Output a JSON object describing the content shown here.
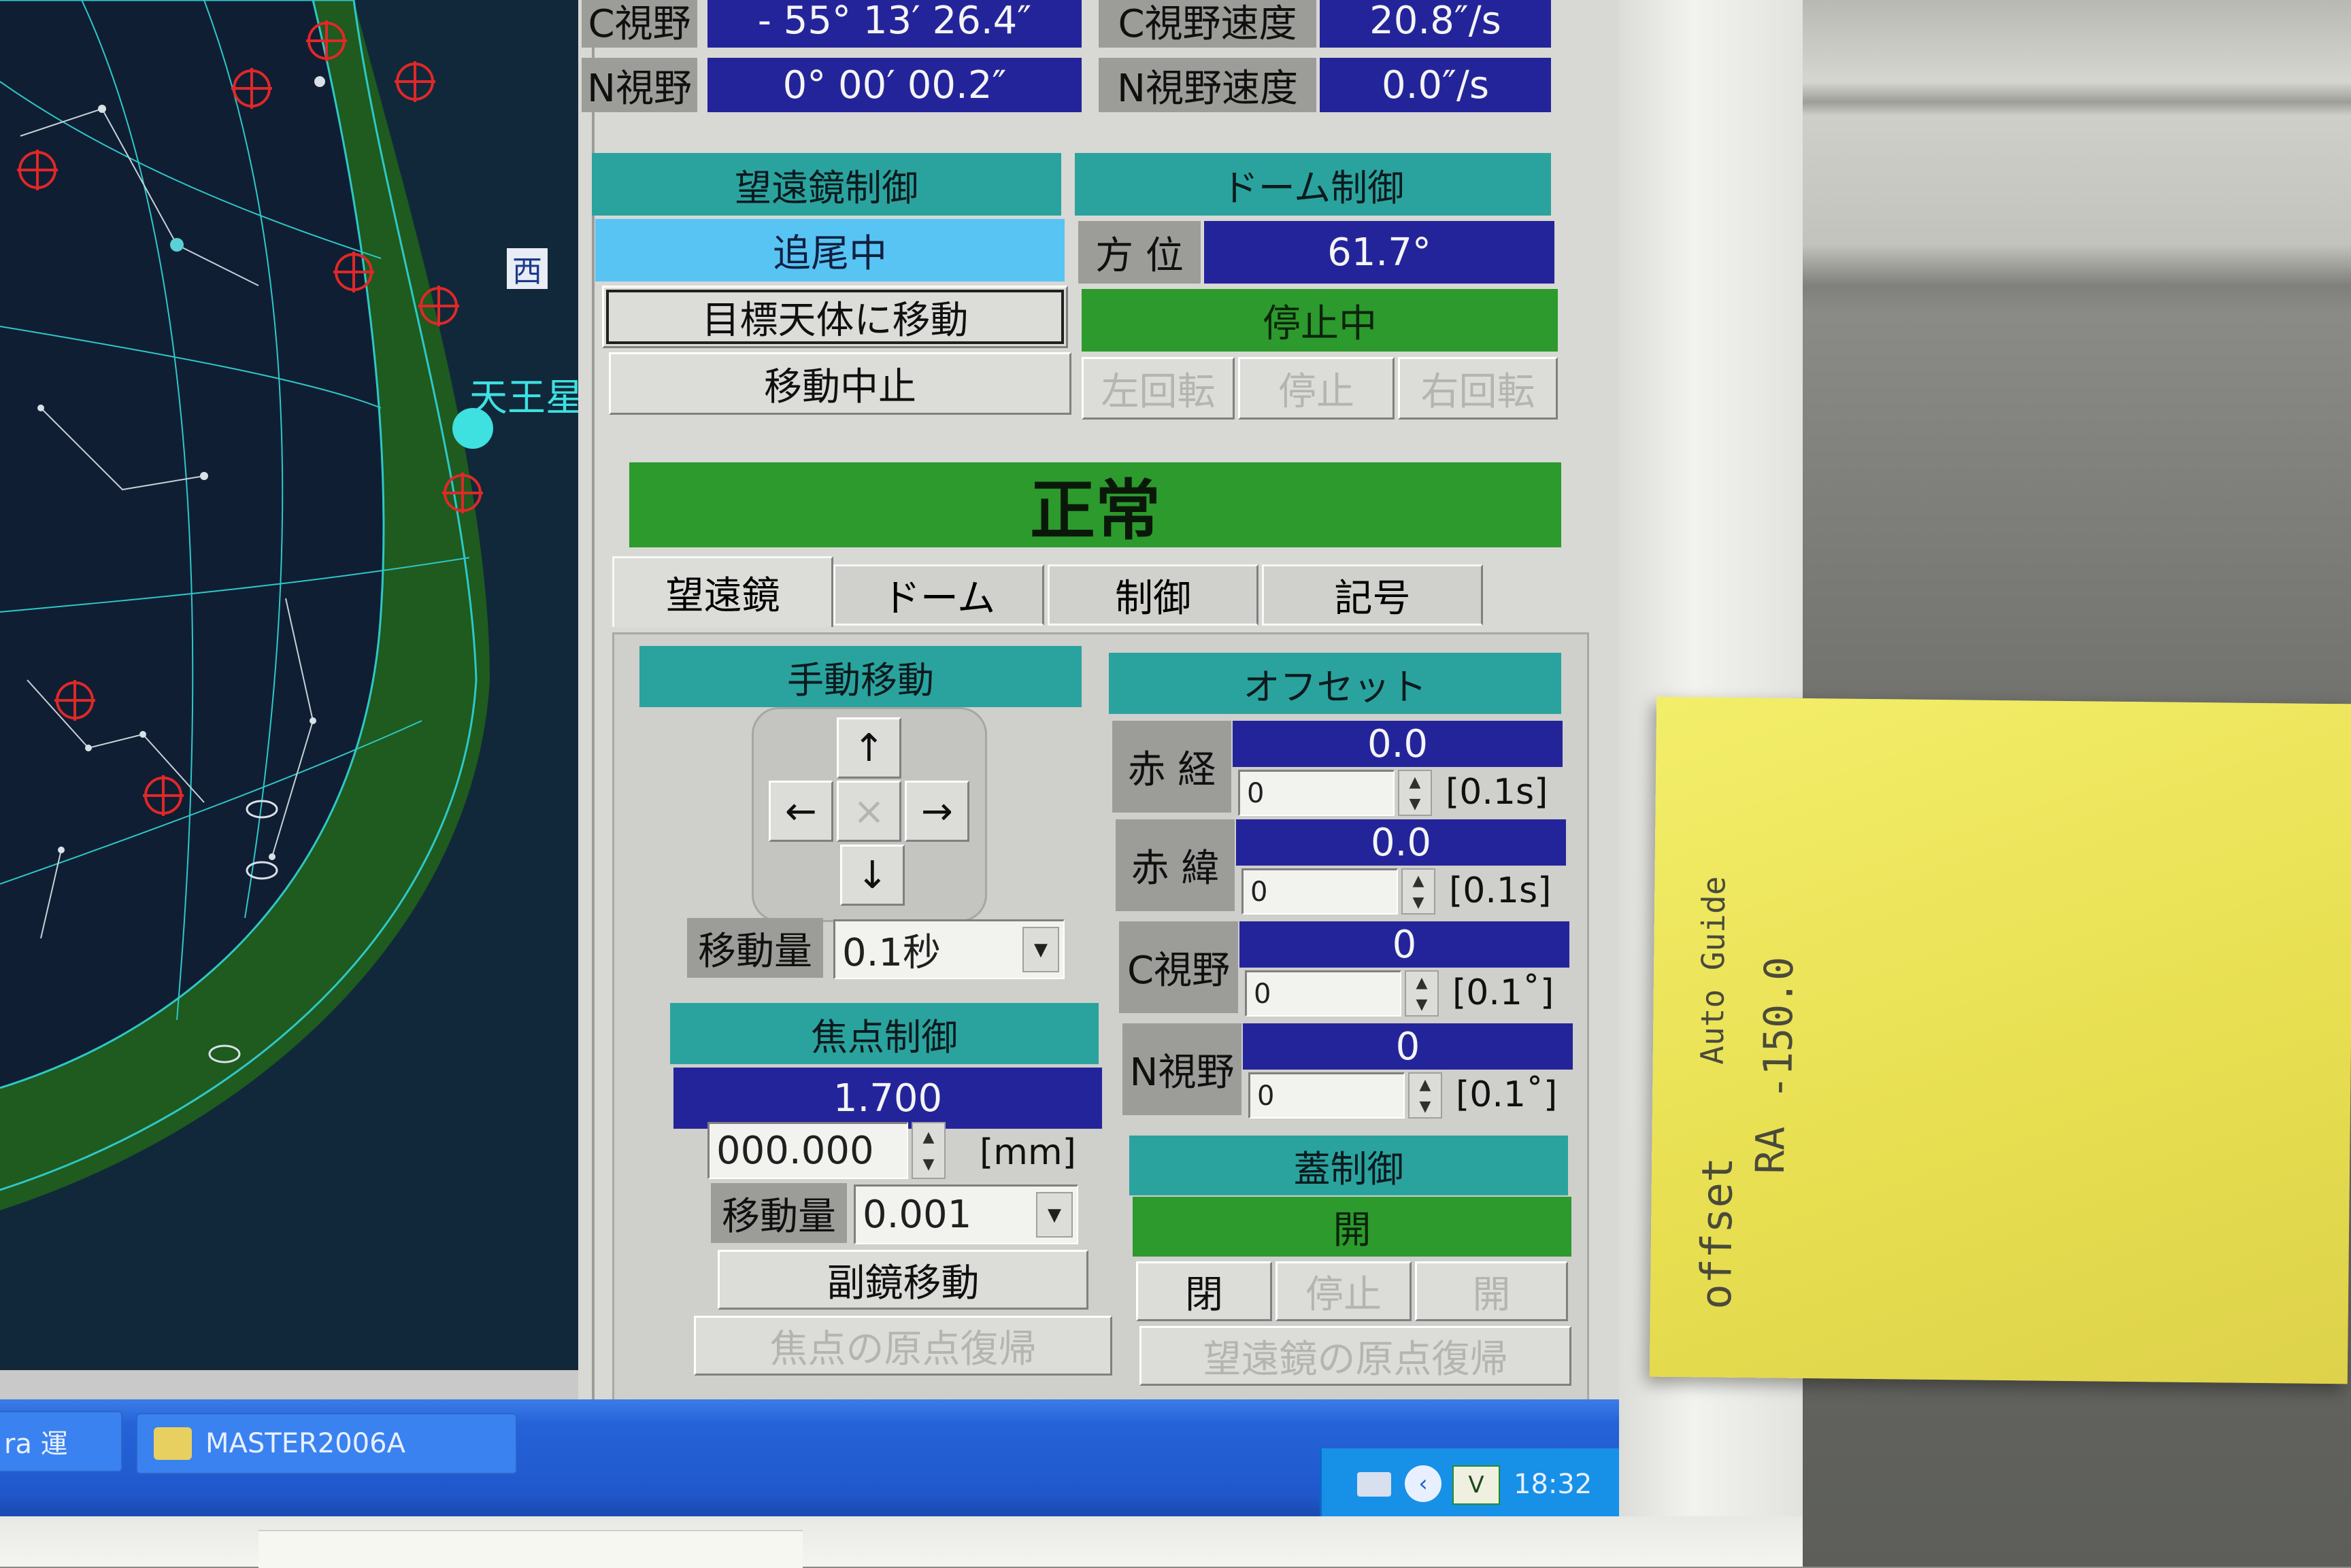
{
  "coord": {
    "c_label": "C視野",
    "c_value": "- 55° 13′ 26.4″",
    "c_speed_label": "C視野速度",
    "c_speed_value": "20.8″/s",
    "n_label": "N視野",
    "n_value": "0° 00′ 00.2″",
    "n_speed_label": "N視野速度",
    "n_speed_value": "0.0″/s"
  },
  "telescope": {
    "header": "望遠鏡制御",
    "status": "追尾中",
    "goto_button": "目標天体に移動",
    "stop_button": "移動中止"
  },
  "dome": {
    "header": "ドーム制御",
    "azimuth_label": "方 位",
    "azimuth_value": "61.7°",
    "status": "停止中",
    "left_button": "左回転",
    "stop_button": "停止",
    "right_button": "右回転"
  },
  "system_status": "正常",
  "tabs": [
    "望遠鏡",
    "ドーム",
    "制御",
    "記号"
  ],
  "manual": {
    "header": "手動移動",
    "up": "↑",
    "down": "↓",
    "left": "←",
    "right": "→",
    "center": "×",
    "amount_label": "移動量",
    "amount_value": "0.1秒"
  },
  "focus": {
    "header": "焦点制御",
    "value": "1.700",
    "input_value": "000.000",
    "unit": "[mm]",
    "amount_label": "移動量",
    "amount_value": "0.001",
    "secondary_button": "副鏡移動",
    "home_button": "焦点の原点復帰"
  },
  "offset": {
    "header": "オフセット",
    "rows": [
      {
        "label": "赤 経",
        "value": "0.0",
        "input": "0",
        "unit": "[0.1s]"
      },
      {
        "label": "赤 緯",
        "value": "0.0",
        "input": "0",
        "unit": "[0.1s]"
      },
      {
        "label": "C視野",
        "value": "0",
        "input": "0",
        "unit": "[0.1˚]"
      },
      {
        "label": "N視野",
        "value": "0",
        "input": "0",
        "unit": "[0.1˚]"
      }
    ]
  },
  "cover": {
    "header": "蓋制御",
    "status": "開",
    "close_button": "閉",
    "stop_button": "停止",
    "open_button": "開",
    "home_button": "望遠鏡の原点復帰"
  },
  "starmap": {
    "west_label": "西",
    "planet_label": "天王星"
  },
  "taskbar": {
    "item1": "ra 運",
    "item2": "MASTER2006A",
    "time": "18:32"
  },
  "note": {
    "line1": "offset",
    "line2": "RA",
    "line3": "Auto Guide",
    "line4": "-150.0"
  },
  "colors": {
    "teal": "#24a19a",
    "navy": "#24249a",
    "green": "#2c9a2c",
    "light_blue": "#58c4f4",
    "starmap_bg": "#11283a",
    "grid": "#2ec8c8",
    "marker": "#e02828"
  }
}
